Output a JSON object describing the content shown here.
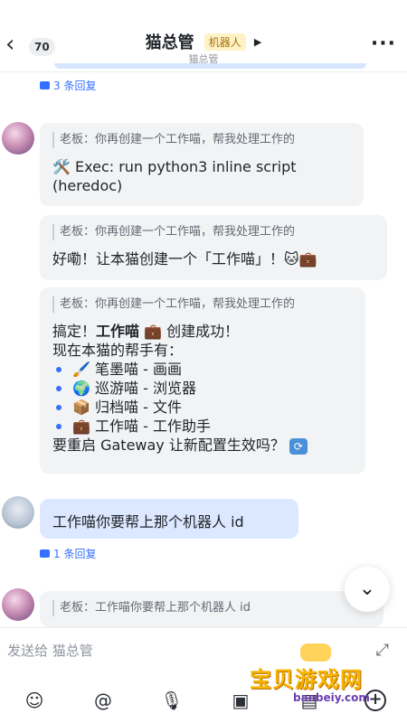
{
  "header": {
    "back_icon": "chevron-left-icon",
    "unread_count": "70",
    "title": "猫总管",
    "bot_tag": "机器人",
    "subtitle": "猫总管",
    "more_icon": "more-dots-icon"
  },
  "thread_top": {
    "reply_label": "3 条回复"
  },
  "messages": [
    {
      "quote": "老板：你再创建一个工作喵，帮我处理工作的",
      "text": "🛠️ Exec: run python3 inline script (heredoc)"
    },
    {
      "quote": "老板：你再创建一个工作喵，帮我处理工作的",
      "text": "好嘞！让本猫创建一个「工作喵」！🐱💼"
    },
    {
      "quote": "老板：你再创建一个工作喵，帮我处理工作的",
      "lead_a": "搞定！",
      "lead_bold": "工作喵",
      "lead_b": " 💼 创建成功！",
      "subhead": "现在本猫的帮手有：",
      "helpers": [
        "🖌️ 笔墨喵 - 画画",
        "🌍 巡游喵 - 浏览器",
        "📦 归档喵 - 文件",
        "💼 工作喵 - 工作助手"
      ],
      "closing": "要重启 Gateway 让新配置生效吗？"
    }
  ],
  "user_message": {
    "text": "工作喵你要帮上那个机器人 id",
    "reply_label": "1 条回复"
  },
  "last_quote": "老板：工作喵你要帮上那个机器人 id",
  "composer": {
    "placeholder": "发送给 猫总管"
  },
  "watermark": {
    "brand": "宝贝游戏网",
    "url": "baobeiy.com"
  },
  "colors": {
    "accent": "#3370ff",
    "user_bubble": "#dbe8ff",
    "bubble": "#f2f3f5"
  }
}
